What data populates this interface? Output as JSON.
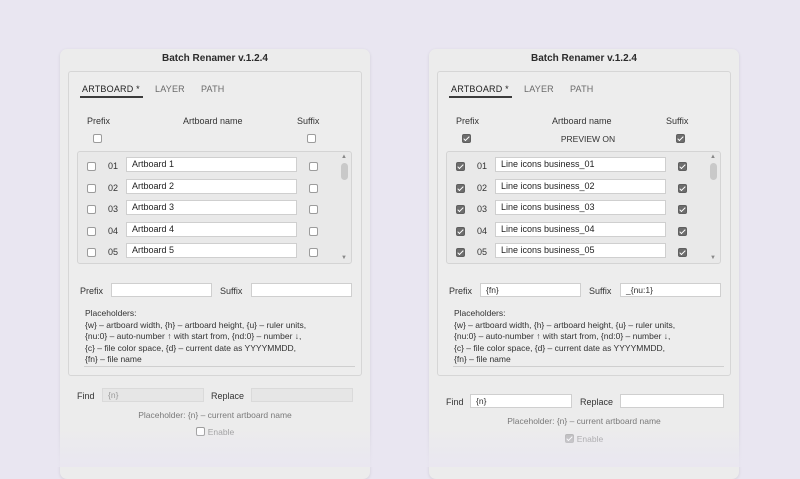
{
  "windows": [
    {
      "title": "Batch Renamer v.1.2.4",
      "tabs": [
        {
          "label": "ARTBOARD *",
          "active": true
        },
        {
          "label": "LAYER",
          "active": false
        },
        {
          "label": "PATH",
          "active": false
        }
      ],
      "columns": {
        "prefix": "Prefix",
        "name": "Artboard name",
        "suffix": "Suffix"
      },
      "header_prefix_checked": false,
      "header_suffix_checked": false,
      "preview_label": "",
      "rows": [
        {
          "num": "01",
          "name": "Artboard 1",
          "prefix_checked": false,
          "suffix_checked": false
        },
        {
          "num": "02",
          "name": "Artboard 2",
          "prefix_checked": false,
          "suffix_checked": false
        },
        {
          "num": "03",
          "name": "Artboard 3",
          "prefix_checked": false,
          "suffix_checked": false
        },
        {
          "num": "04",
          "name": "Artboard 4",
          "prefix_checked": false,
          "suffix_checked": false
        },
        {
          "num": "05",
          "name": "Artboard 5",
          "prefix_checked": false,
          "suffix_checked": false
        }
      ],
      "prefix_label": "Prefix",
      "prefix_value": "",
      "suffix_label": "Suffix",
      "suffix_value": "",
      "placeholders": [
        "Placeholders:",
        "{w} – artboard width, {h} – artboard height, {u} – ruler units,",
        "{nu:0} – auto-number ↑ with start from, {nd:0} – number ↓,",
        "{c} – file color space, {d} – current date as YYYYMMDD,",
        "{fn} – file name"
      ],
      "find_label": "Find",
      "find_value": "{n}",
      "replace_label": "Replace",
      "replace_value": "",
      "find_enabled": false,
      "hint": "Placeholder: {n} – current artboard name",
      "enable_label": "Enable",
      "enable_checked": false
    },
    {
      "title": "Batch Renamer v.1.2.4",
      "tabs": [
        {
          "label": "ARTBOARD *",
          "active": true
        },
        {
          "label": "LAYER",
          "active": false
        },
        {
          "label": "PATH",
          "active": false
        }
      ],
      "columns": {
        "prefix": "Prefix",
        "name": "Artboard name",
        "suffix": "Suffix"
      },
      "header_prefix_checked": true,
      "header_suffix_checked": true,
      "preview_label": "PREVIEW ON",
      "rows": [
        {
          "num": "01",
          "name": "Line icons business_01",
          "prefix_checked": true,
          "suffix_checked": true
        },
        {
          "num": "02",
          "name": "Line icons business_02",
          "prefix_checked": true,
          "suffix_checked": true
        },
        {
          "num": "03",
          "name": "Line icons business_03",
          "prefix_checked": true,
          "suffix_checked": true
        },
        {
          "num": "04",
          "name": "Line icons business_04",
          "prefix_checked": true,
          "suffix_checked": true
        },
        {
          "num": "05",
          "name": "Line icons business_05",
          "prefix_checked": true,
          "suffix_checked": true
        }
      ],
      "prefix_label": "Prefix",
      "prefix_value": "{fn}",
      "suffix_label": "Suffix",
      "suffix_value": "_{nu:1}",
      "placeholders": [
        "Placeholders:",
        "{w} – artboard width, {h} – artboard height, {u} – ruler units,",
        "{nu:0} – auto-number ↑ with start from, {nd:0} – number ↓,",
        "{c} – file color space, {d} – current date as YYYYMMDD,",
        "{fn} – file name"
      ],
      "find_label": "Find",
      "find_value": "{n}",
      "replace_label": "Replace",
      "replace_value": "",
      "find_enabled": true,
      "hint": "Placeholder: {n} – current artboard name",
      "enable_label": "Enable",
      "enable_checked": true
    }
  ]
}
